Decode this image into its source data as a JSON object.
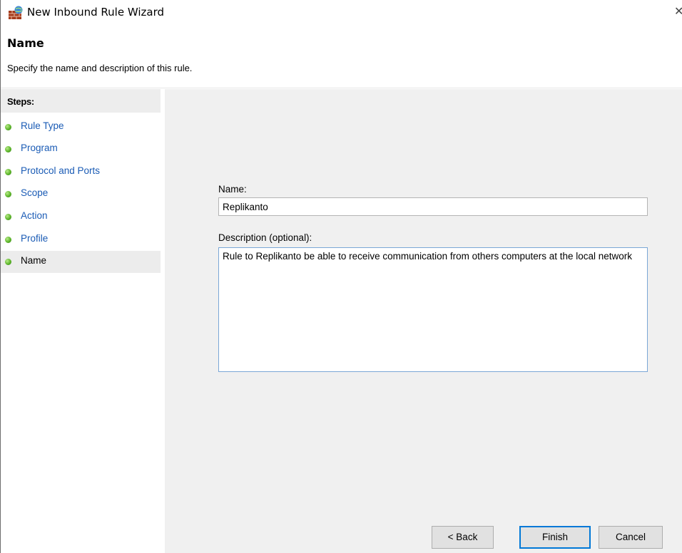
{
  "window": {
    "title": "New Inbound Rule Wizard",
    "close_glyph": "✕",
    "icon": "firewall-wall-icon"
  },
  "header": {
    "title": "Name",
    "description": "Specify the name and description of this rule."
  },
  "steps": {
    "heading": "Steps:",
    "items": [
      {
        "label": "Rule Type",
        "current": false
      },
      {
        "label": "Program",
        "current": false
      },
      {
        "label": "Protocol and Ports",
        "current": false
      },
      {
        "label": "Scope",
        "current": false
      },
      {
        "label": "Action",
        "current": false
      },
      {
        "label": "Profile",
        "current": false
      },
      {
        "label": "Name",
        "current": true
      }
    ]
  },
  "form": {
    "name_label": "Name:",
    "name_value": "Replikanto",
    "description_label": "Description (optional):",
    "description_value": "Rule to Replikanto be able to receive communication from others computers at the local network"
  },
  "buttons": {
    "back": "< Back",
    "finish": "Finish",
    "cancel": "Cancel"
  },
  "colors": {
    "step_link": "#1a5bb5",
    "step_dot": "#5db52a",
    "content_bg": "#f0f0f0",
    "focus_border": "#0078d7"
  }
}
